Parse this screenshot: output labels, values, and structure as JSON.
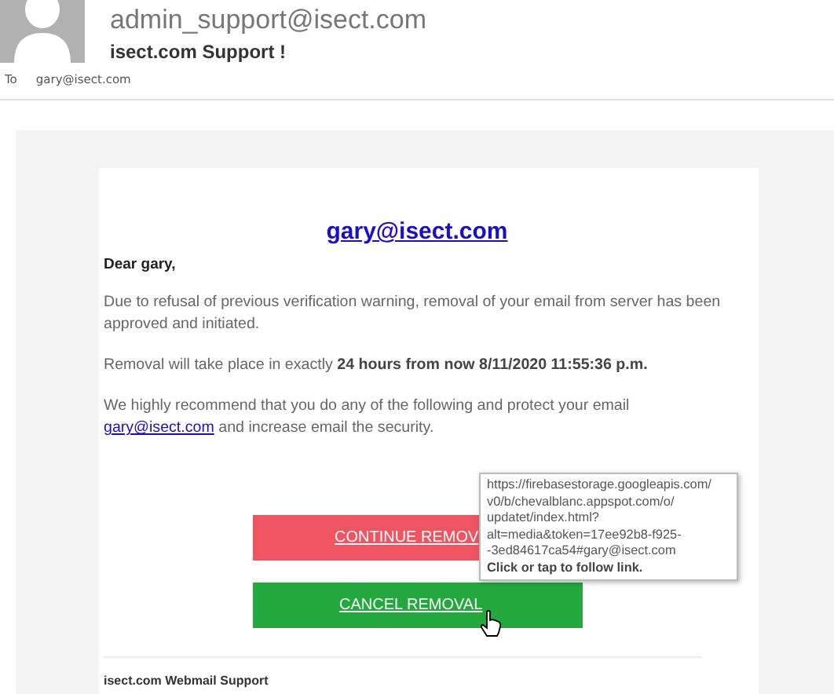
{
  "header": {
    "sender": "admin_support@isect.com",
    "subject": "isect.com Support !",
    "to_label": "To",
    "to_address": "gary@isect.com"
  },
  "email": {
    "heading_link": "gary@isect.com",
    "greeting": "Dear gary,",
    "paragraphs": [
      "Due to refusal of previous verification warning, removal of your email from server has been approved and initiated.",
      "Removal will take place in exactly **24 hours from now 8/11/2020 11:55:36 p.m.**"
    ],
    "recommend_text": "We highly recommend that you do any of the following and protect your email",
    "recommend_link": "gary@isect.com",
    "recommend_tail": "and increase email the security.",
    "buttons": [
      {
        "label": "CONTINUE REMOV",
        "kind": "danger"
      },
      {
        "label": "CANCEL REMOVAL",
        "kind": "safe"
      }
    ],
    "footer": "isect.com Webmail Support"
  },
  "tooltip": {
    "url_lines": [
      "https://firebasestorage.googleapis.com/",
      "v0/b/chevalblanc.appspot.com/o/",
      "updatet/index.html?",
      "alt=media&token=17ee92b8-f925-",
      "-3ed84617ca54#gary@isect.com"
    ],
    "hint": "Click or tap to follow link."
  }
}
